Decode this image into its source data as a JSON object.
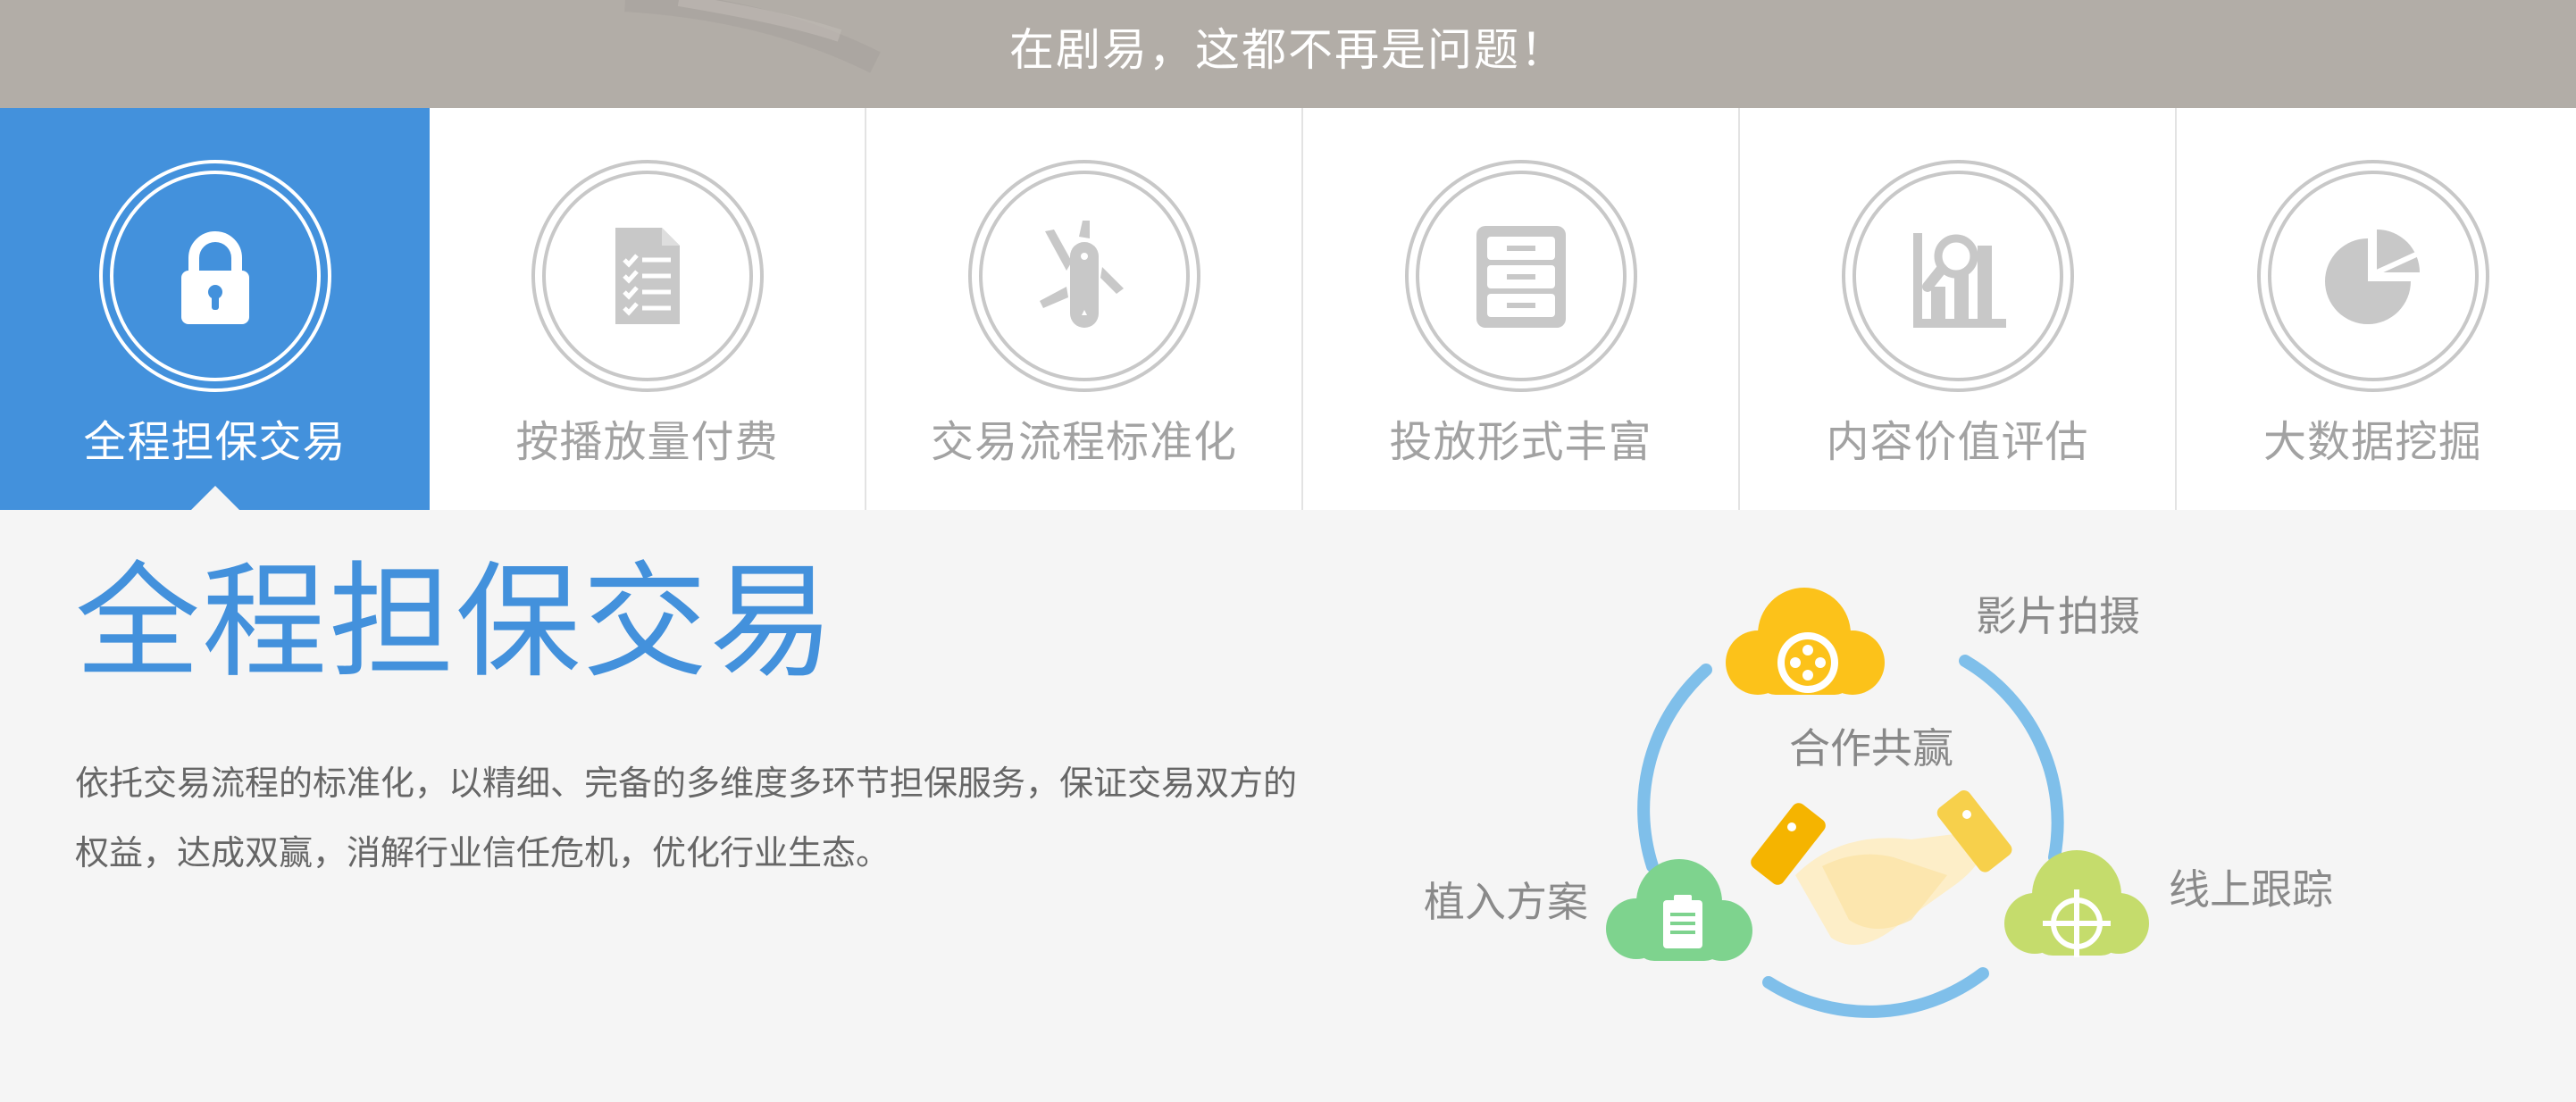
{
  "banner": {
    "text": "在剧易，这都不再是问题！"
  },
  "tabs": [
    {
      "label": "全程担保交易",
      "icon": "lock-icon",
      "active": true
    },
    {
      "label": "按播放量付费",
      "icon": "checklist-document-icon",
      "active": false
    },
    {
      "label": "交易流程标准化",
      "icon": "swiss-knife-icon",
      "active": false
    },
    {
      "label": "投放形式丰富",
      "icon": "cabinet-icon",
      "active": false
    },
    {
      "label": "内容价值评估",
      "icon": "chart-magnifier-icon",
      "active": false
    },
    {
      "label": "大数据挖掘",
      "icon": "pie-chart-icon",
      "active": false
    }
  ],
  "content": {
    "title": "全程担保交易",
    "description": "依托交易流程的标准化，以精细、完备的多维度多环节担保服务，保证交易双方的权益，达成双赢，消解行业信任危机，优化行业生态。"
  },
  "diagram": {
    "center_label": "合作共赢",
    "top_label": "影片拍摄",
    "left_label": "植入方案",
    "right_label": "线上跟踪"
  },
  "colors": {
    "accent": "#4391dc",
    "banner_bg": "#b2ada7",
    "inactive_icon": "#c8c8c8",
    "cloud_yellow": "#fcc21a",
    "cloud_green": "#7ed38e",
    "cloud_lime": "#c5dc6c",
    "ring_blue": "#7fbfea"
  }
}
